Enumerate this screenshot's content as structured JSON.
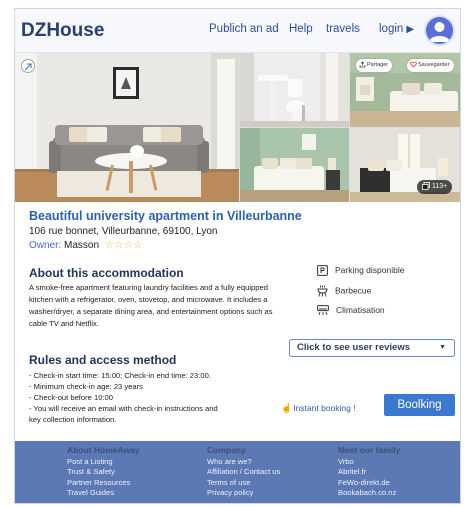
{
  "header": {
    "logo": "DZHouse",
    "nav": [
      "Publich an ad",
      "Help",
      "travels",
      "login"
    ]
  },
  "gallery": {
    "share_label": "Partager",
    "save_label": "Sauvegarder",
    "more_photos": "113+"
  },
  "listing": {
    "title": "Beautiful university apartment in Villeurbanne",
    "address": "106 rue bonnet, Villeurbanne, 69100, Lyon",
    "owner_label": "Owner:",
    "owner_name": "Masson",
    "rating_stars": "☆☆☆☆",
    "rating_value": 4
  },
  "about": {
    "heading": "About this accommodation",
    "description": "A smoke-free apartment featuring laundry facilities and a fully equipped kitchen with a refrigerator, oven, stovetop, and microwave. It includes a washer/dryer, a separate dining area, and entertainment options such as cable TV and Netflix."
  },
  "amenities": [
    {
      "label": "Parking disponible",
      "icon": "parking-icon"
    },
    {
      "label": "Barbecue",
      "icon": "barbecue-icon"
    },
    {
      "label": "Climatisation",
      "icon": "air-conditioner-icon"
    }
  ],
  "reviews": {
    "label": "Click to see user reviews"
  },
  "rules": {
    "heading": "Rules and access method",
    "items": [
      "- Check-in start time: 15:00; Check-in end time: 23:00.",
      "- Minimum check-in age: 23 years",
      "- Check-out before 10:00",
      "- You will receive an email with check-in instructions and",
      "key collection information."
    ]
  },
  "booking": {
    "instant_label": "Instant booking !",
    "button_label": "Boolking"
  },
  "footer": {
    "columns": [
      {
        "heading": "About HomeAway",
        "links": [
          "Post a Listing",
          "Trust & Safety",
          "Partner Resources",
          "Travel Guides"
        ]
      },
      {
        "heading": "Company",
        "links": [
          "Who are we?",
          "Affiliation / Contact us",
          "Terms of use",
          "Privacy policy"
        ]
      },
      {
        "heading": "Meet our family",
        "links": [
          "Vrbo",
          "Abritel.fr",
          "FeWo-direkt.de",
          "Bookabach.co.nz"
        ]
      }
    ]
  },
  "colors": {
    "brand_blue": "#2d61b0",
    "button_blue": "#3d78cf",
    "footer_bg": "#5c79b4",
    "header_bg": "#f6f8fc"
  }
}
